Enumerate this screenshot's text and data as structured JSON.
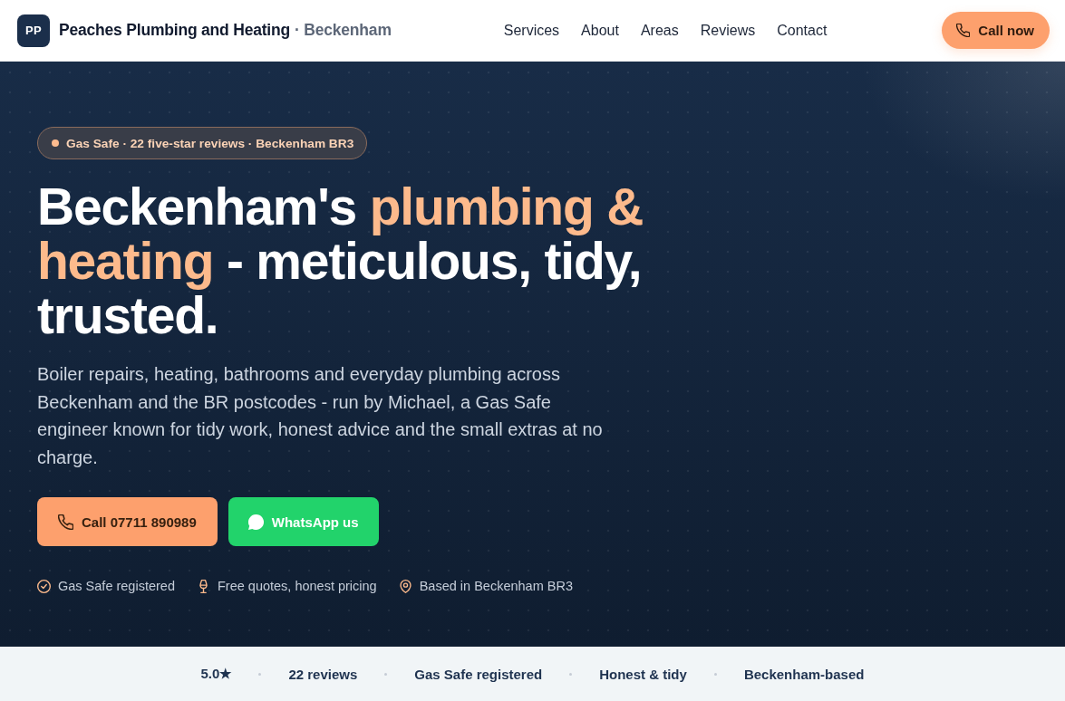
{
  "header": {
    "logo": {
      "initials": "PP"
    },
    "brand": "Peaches Plumbing and Heating",
    "location": "· Beckenham",
    "nav": [
      "Services",
      "About",
      "Areas",
      "Reviews",
      "Contact"
    ],
    "cta": {
      "kind": "phone",
      "label": "Call now"
    }
  },
  "hero": {
    "badge": "Gas Safe · 22 five-star reviews · Beckenham BR3",
    "headline": [
      {
        "text": "Beckenham's ",
        "highlight": false
      },
      {
        "text": "plumbing & heating",
        "highlight": true
      },
      {
        "text": " - meticulous, tidy, trusted.",
        "highlight": false
      }
    ],
    "intro": "Boiler repairs, heating, bathrooms and everyday plumbing across Beckenham and the BR postcodes - run by Michael, a Gas Safe engineer known for tidy work, honest advice and the small extras at no charge.",
    "buttons": [
      {
        "kind": "phone",
        "label": "Call 07711 890989"
      },
      {
        "kind": "whatsapp",
        "label": "WhatsApp us"
      }
    ],
    "features": [
      {
        "kind": "check",
        "label": "Gas Safe registered"
      },
      {
        "kind": "goblet",
        "label": "Free quotes, honest pricing"
      },
      {
        "kind": "pin",
        "label": "Based in Beckenham BR3"
      }
    ]
  },
  "trust_bar": [
    "5.0★",
    "22 reviews",
    "Gas Safe registered",
    "Honest & tidy",
    "Beckenham-based"
  ]
}
